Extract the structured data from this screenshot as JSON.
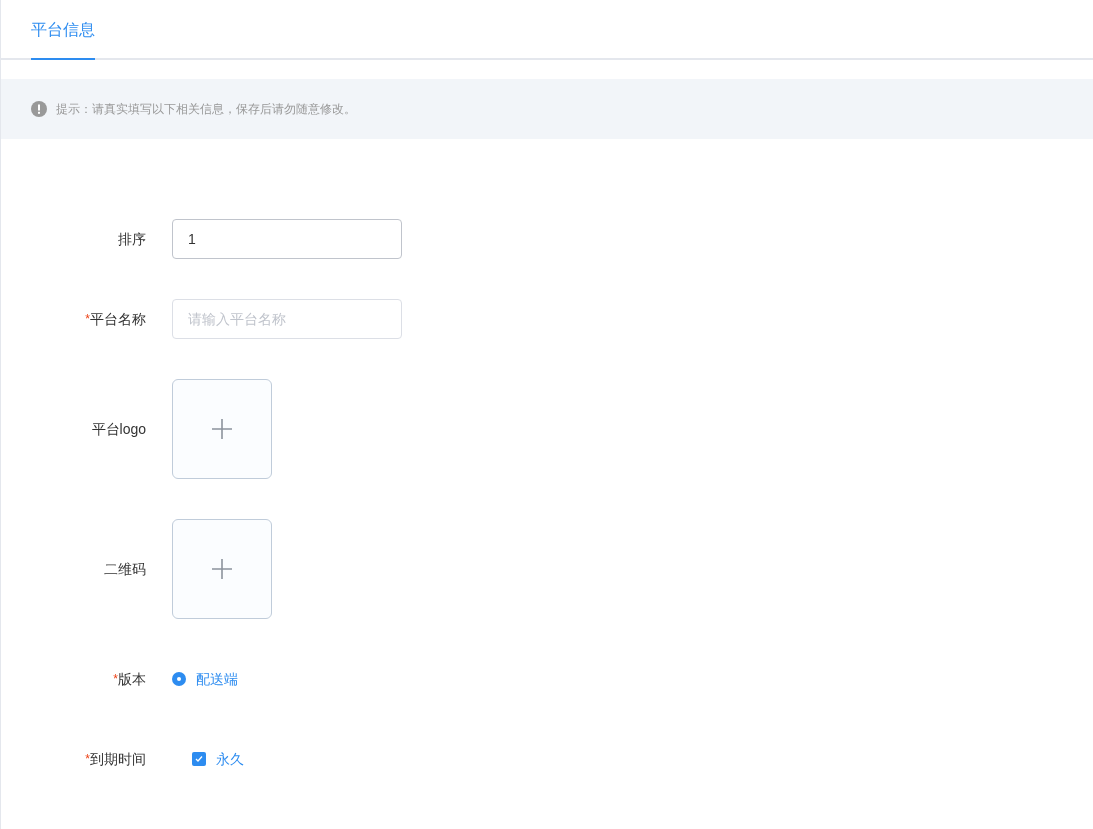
{
  "tabs": [
    {
      "label": "平台信息",
      "selected": true
    }
  ],
  "notice": {
    "text": "提示：请真实填写以下相关信息，保存后请勿随意修改。"
  },
  "form": [
    {
      "kind": "text",
      "label": "排序",
      "value": "1"
    },
    {
      "kind": "text",
      "mark": "*",
      "label": "平台名称",
      "placeholder": "请输入平台名称"
    },
    {
      "kind": "upload",
      "label": "平台logo"
    },
    {
      "kind": "upload",
      "label": "二维码"
    },
    {
      "kind": "radio",
      "mark": "*",
      "label": "版本",
      "option": "配送端",
      "selected": true
    },
    {
      "kind": "checkbox",
      "mark": "*",
      "label": "到期时间",
      "option": "永久",
      "checked": true
    }
  ]
}
